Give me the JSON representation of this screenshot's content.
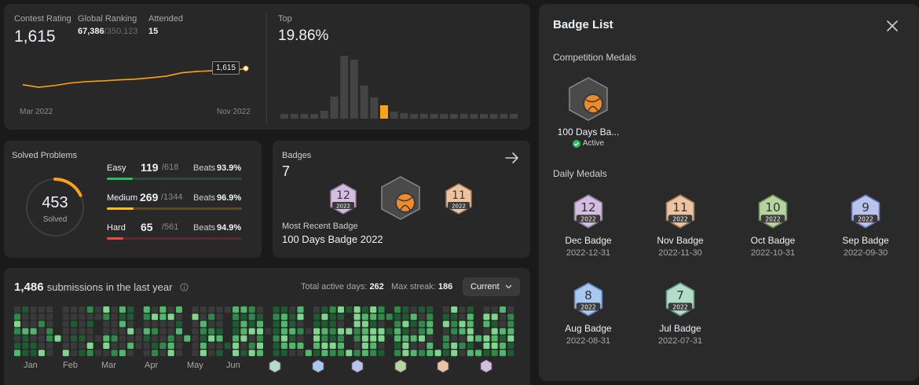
{
  "rating": {
    "contest_rating_label": "Contest Rating",
    "contest_rating_value": "1,615",
    "global_ranking_label": "Global Ranking",
    "global_ranking_value": "67,386",
    "global_ranking_total": "/350,123",
    "attended_label": "Attended",
    "attended_value": "15",
    "tooltip_value": "1,615",
    "x_start": "Mar 2022",
    "x_end": "Nov 2022",
    "top_label": "Top",
    "top_value": "19.86%"
  },
  "chart_data": [
    {
      "type": "line",
      "x": [
        "Mar 2022",
        "",
        "",
        "",
        "",
        "",
        "",
        "",
        "",
        "",
        "",
        "",
        "",
        "",
        "Nov 2022"
      ],
      "values": [
        1520,
        1505,
        1515,
        1530,
        1538,
        1542,
        1548,
        1552,
        1560,
        1570,
        1590,
        1598,
        1602,
        1600,
        1615
      ],
      "ylim": [
        1450,
        1680
      ],
      "title": "",
      "xlabel": "",
      "ylabel": ""
    },
    {
      "type": "bar",
      "categories": [],
      "values": [
        3,
        3,
        3,
        4,
        10,
        28,
        80,
        75,
        42,
        27,
        17,
        9,
        7,
        6,
        6,
        6,
        6,
        6,
        6,
        6,
        6,
        6,
        6,
        6
      ],
      "highlight_index": 10,
      "title": "",
      "xlabel": "",
      "ylabel": ""
    }
  ],
  "solved": {
    "title": "Solved Problems",
    "total": "453",
    "total_label": "Solved",
    "progress_fraction": 0.18,
    "difficulties": [
      {
        "label": "Easy",
        "count": "119",
        "total": "/618",
        "beats_label": "Beats",
        "beats": "93.9%",
        "fraction": 0.19,
        "color": "#2cbb5d",
        "track": "#2a4a34"
      },
      {
        "label": "Medium",
        "count": "269",
        "total": "/1344",
        "beats_label": "Beats",
        "beats": "96.9%",
        "fraction": 0.2,
        "color": "#ffc01e",
        "track": "#5a4a25"
      },
      {
        "label": "Hard",
        "count": "65",
        "total": "/561",
        "beats_label": "Beats",
        "beats": "94.9%",
        "fraction": 0.12,
        "color": "#ef4743",
        "track": "#5a2a2a"
      }
    ]
  },
  "badges": {
    "title": "Badges",
    "count": "7",
    "most_recent_label": "Most Recent Badge",
    "most_recent_value": "100 Days Badge 2022",
    "featured": [
      {
        "num": "12",
        "year": "2022",
        "color": "#c9b3d6"
      },
      {
        "num": "",
        "year": "",
        "color": "#555"
      },
      {
        "num": "11",
        "year": "2022",
        "color": "#e4b894"
      }
    ]
  },
  "submissions": {
    "count": "1,486",
    "label": "submissions in the last year",
    "active_days_label": "Total active days:",
    "active_days_value": "262",
    "max_streak_label": "Max streak:",
    "max_streak_value": "186",
    "select_value": "Current",
    "months": [
      "Jan",
      "Feb",
      "Mar",
      "Apr",
      "May",
      "Jun"
    ]
  },
  "panel": {
    "title": "Badge List",
    "competition_section": "Competition Medals",
    "competition": [
      {
        "name": "100 Days Ba...",
        "status": "Active"
      }
    ],
    "daily_section": "Daily Medals",
    "daily": [
      {
        "num": "12",
        "year": "2022",
        "name": "Dec Badge",
        "date": "2022-12-31",
        "color": "#d4bde0",
        "stroke": "#8f7aa0"
      },
      {
        "num": "11",
        "year": "2022",
        "name": "Nov Badge",
        "date": "2022-11-30",
        "color": "#ecc4a2",
        "stroke": "#a07a5a"
      },
      {
        "num": "10",
        "year": "2022",
        "name": "Oct Badge",
        "date": "2022-10-31",
        "color": "#b6d3a0",
        "stroke": "#6f8e5a"
      },
      {
        "num": "9",
        "year": "2022",
        "name": "Sep Badge",
        "date": "2022-09-30",
        "color": "#b9c3ef",
        "stroke": "#6b78b2"
      },
      {
        "num": "8",
        "year": "2022",
        "name": "Aug Badge",
        "date": "2022-08-31",
        "color": "#a9c7ef",
        "stroke": "#5d82b2"
      },
      {
        "num": "7",
        "year": "2022",
        "name": "Jul Badge",
        "date": "2022-07-31",
        "color": "#b2dcc9",
        "stroke": "#5e9a80"
      }
    ]
  },
  "colors": {
    "accent": "#ffa116",
    "easy": "#2cbb5d",
    "medium": "#ffc01e",
    "hard": "#ef4743",
    "active": "#2cbb5d"
  }
}
